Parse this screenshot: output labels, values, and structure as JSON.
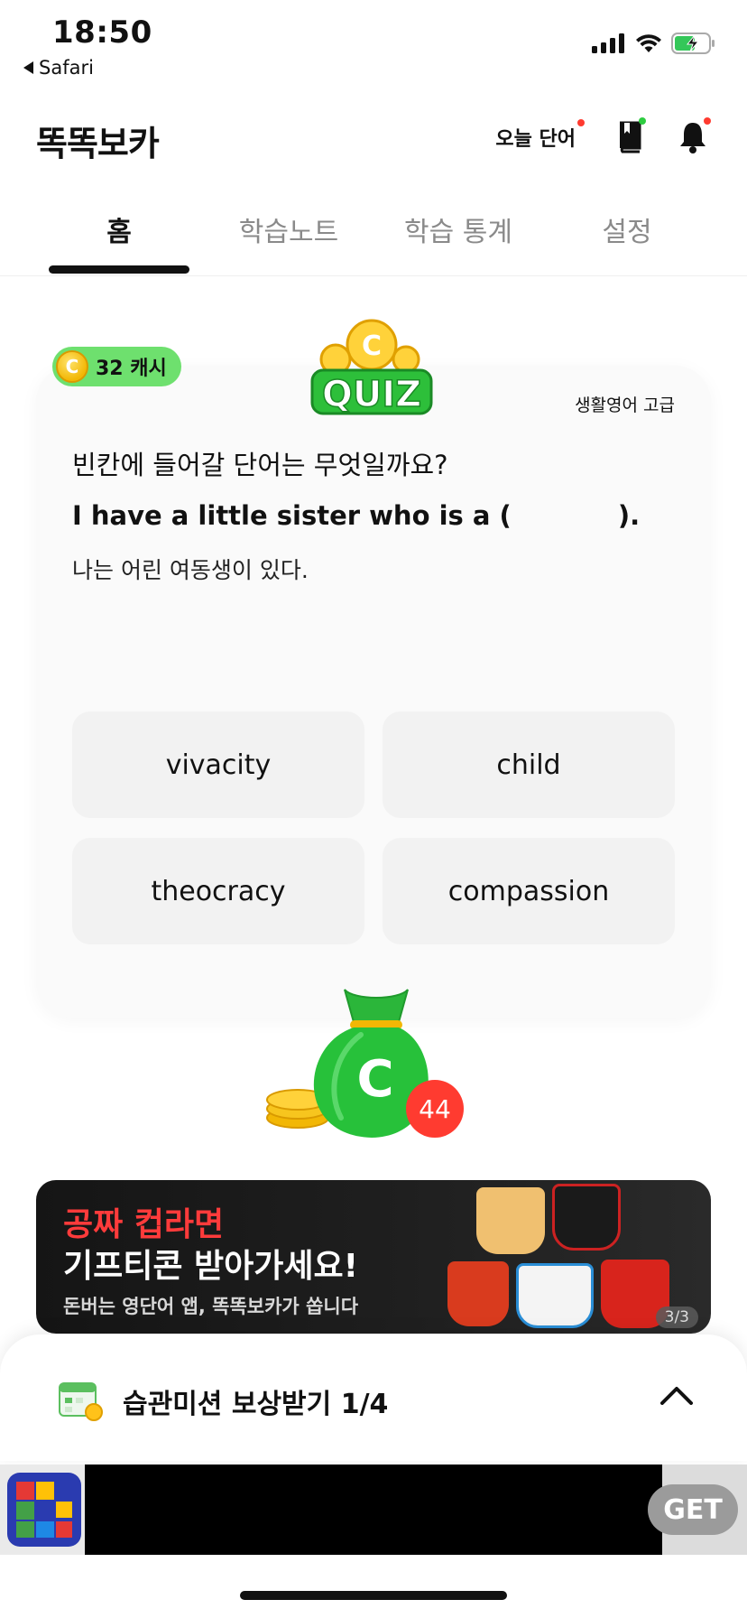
{
  "status_bar": {
    "time": "18:50",
    "back_app": "Safari"
  },
  "header": {
    "title": "똑똑보카",
    "today_word": "오늘 단어"
  },
  "tabs": [
    {
      "label": "홈",
      "active": true
    },
    {
      "label": "학습노트",
      "active": false
    },
    {
      "label": "학습 통계",
      "active": false
    },
    {
      "label": "설정",
      "active": false
    }
  ],
  "quiz": {
    "cash_label": "32 캐시",
    "coin_symbol": "C",
    "logo_text": "QUIZ",
    "level": "생활영어 고급",
    "question": "빈칸에 들어갈 단어는 무엇일까요?",
    "sentence_before": "I have a little sister who is a (",
    "sentence_after": ").",
    "translation": "나는 어린 여동생이 있다.",
    "options": [
      "vivacity",
      "child",
      "theocracy",
      "compassion"
    ]
  },
  "money_bag": {
    "symbol": "C",
    "count": "44"
  },
  "banner": {
    "line1": "공짜 컵라면",
    "line2": "기프티콘 받아가세요!",
    "line3": "돈버는 영단어 앱, 똑똑보카가 쏩니다",
    "page_indicator": "3/3"
  },
  "mission": {
    "label": "습관미션 보상받기 1/4"
  },
  "ad": {
    "get_label": "GET"
  },
  "colors": {
    "accent_green": "#6ee06e",
    "notify_red": "#ff3b30",
    "banner_red": "#ff3b3b"
  }
}
